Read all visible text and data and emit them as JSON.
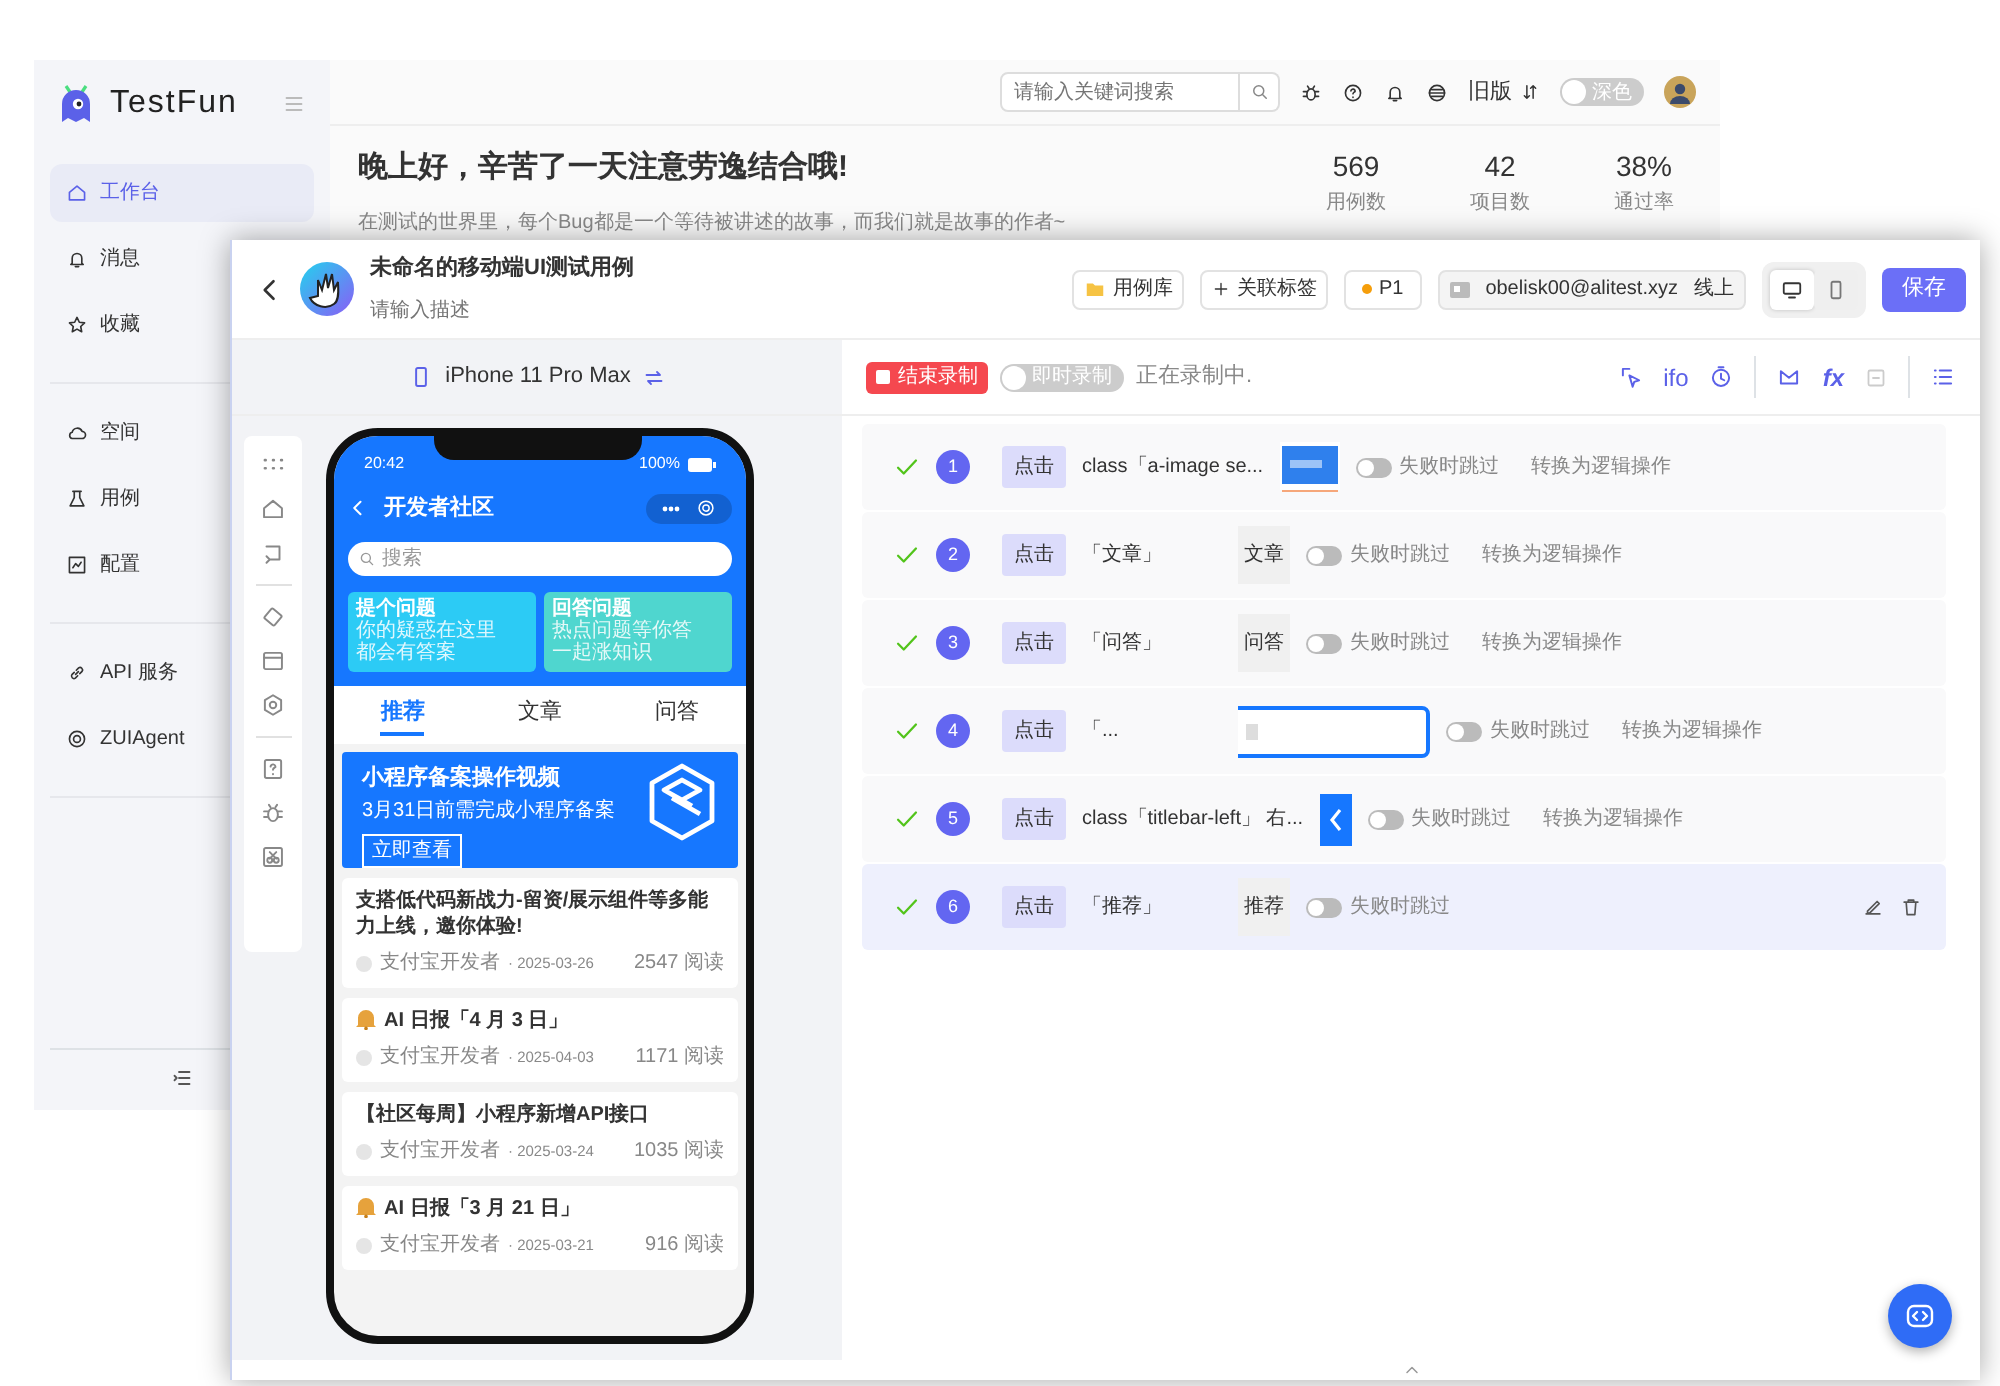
{
  "app": {
    "logo": "TestFun",
    "nav_sections": [
      {
        "items": [
          {
            "label": "工作台",
            "selected": true
          },
          {
            "label": "消息",
            "selected": false
          },
          {
            "label": "收藏",
            "selected": false
          }
        ]
      },
      {
        "items": [
          {
            "label": "空间",
            "selected": false
          },
          {
            "label": "用例",
            "selected": false
          },
          {
            "label": "配置",
            "selected": false
          }
        ]
      },
      {
        "items": [
          {
            "label": "API 服务",
            "selected": false
          },
          {
            "label": "ZUIAgent",
            "selected": false
          }
        ]
      }
    ],
    "search": {
      "placeholder": "请输入关键词搜索"
    },
    "old_version": "旧版",
    "theme_toggle": {
      "label": "深色",
      "on": false
    },
    "greeting": {
      "title": "晚上好，辛苦了一天注意劳逸结合哦!",
      "subtitle": "在测试的世界里，每个Bug都是一个等待被讲述的故事，而我们就是故事的作者~"
    },
    "stats": [
      {
        "value": "569",
        "label": "用例数"
      },
      {
        "value": "42",
        "label": "项目数"
      },
      {
        "value": "38%",
        "label": "通过率"
      }
    ]
  },
  "case": {
    "title": "未命名的移动端UI测试用例",
    "description": {
      "placeholder": "请输入描述"
    },
    "library": "用例库",
    "tags": "关联标签",
    "priority": "P1",
    "account": "obelisk00@alitest.xyz",
    "env": "线上",
    "view_modes": [
      {
        "kind": "desktop",
        "selected": true
      },
      {
        "kind": "mobile",
        "selected": false
      }
    ],
    "save": "保存"
  },
  "device": {
    "name": "iPhone 11 Pro Max"
  },
  "recording": {
    "stop": "结束录制",
    "instant": {
      "label": "即时录制",
      "on": false
    },
    "status": "正在录制中.",
    "tools": {
      "condition": "ifo",
      "function": "fx"
    }
  },
  "phone": {
    "time": "20:42",
    "battery": "100%",
    "title": "开发者社区",
    "search": {
      "placeholder": "搜索"
    },
    "banners": [
      {
        "title": "提个问题",
        "lines": [
          "你的疑惑在这里",
          "都会有答案"
        ]
      },
      {
        "title": "回答问题",
        "lines": [
          "热点问题等你答",
          "一起涨知识"
        ]
      }
    ],
    "tabs": [
      {
        "label": "推荐",
        "selected": true
      },
      {
        "label": "文章",
        "selected": false
      },
      {
        "label": "问答",
        "selected": false
      }
    ],
    "promo": {
      "title": "小程序备案操作视频",
      "subtitle": "3月31日前需完成小程序备案",
      "button": "立即查看"
    },
    "articles": [
      {
        "kind": "plain",
        "title": "支搭低代码新战力-留资/展示组件等多能力上线，邀你体验!",
        "author": "支付宝开发者",
        "date": "· 2025-03-26",
        "reads": "2547 阅读"
      },
      {
        "kind": "daily",
        "title": "AI 日报「4 月 3 日」",
        "author": "支付宝开发者",
        "date": "· 2025-04-03",
        "reads": "1171 阅读"
      },
      {
        "kind": "plain",
        "title": "【社区每周】小程序新增API接口",
        "author": "支付宝开发者",
        "date": "· 2025-03-24",
        "reads": "1035 阅读"
      },
      {
        "kind": "daily",
        "title": "AI 日报「3 月 21 日」",
        "author": "支付宝开发者",
        "date": "· 2025-03-21",
        "reads": "916 阅读"
      }
    ]
  },
  "steps": [
    {
      "passed": true,
      "number": "1",
      "action": "点击",
      "target": "class「a-image se...",
      "preview": {
        "kind": "image"
      },
      "skip": {
        "label": "失败时跳过",
        "on": false
      },
      "convert": "转换为逻辑操作",
      "selected": false
    },
    {
      "passed": true,
      "number": "2",
      "action": "点击",
      "target": "「文章」",
      "preview": {
        "kind": "text",
        "text": "文章"
      },
      "skip": {
        "label": "失败时跳过",
        "on": false
      },
      "convert": "转换为逻辑操作",
      "selected": false
    },
    {
      "passed": true,
      "number": "3",
      "action": "点击",
      "target": "「问答」",
      "preview": {
        "kind": "text",
        "text": "问答"
      },
      "skip": {
        "label": "失败时跳过",
        "on": false
      },
      "convert": "转换为逻辑操作",
      "selected": false
    },
    {
      "passed": true,
      "number": "4",
      "action": "点击",
      "target": "「...",
      "preview": {
        "kind": "field"
      },
      "skip": {
        "label": "失败时跳过",
        "on": false
      },
      "convert": "转换为逻辑操作",
      "selected": false
    },
    {
      "passed": true,
      "number": "5",
      "action": "点击",
      "target": "class「titlebar-left」 右...",
      "preview": {
        "kind": "back"
      },
      "skip": {
        "label": "失败时跳过",
        "on": false
      },
      "convert": "转换为逻辑操作",
      "selected": false
    },
    {
      "passed": true,
      "number": "6",
      "action": "点击",
      "target": "「推荐」",
      "preview": {
        "kind": "text",
        "text": "推荐"
      },
      "skip": {
        "label": "失败时跳过",
        "on": false
      },
      "selected": true
    }
  ]
}
